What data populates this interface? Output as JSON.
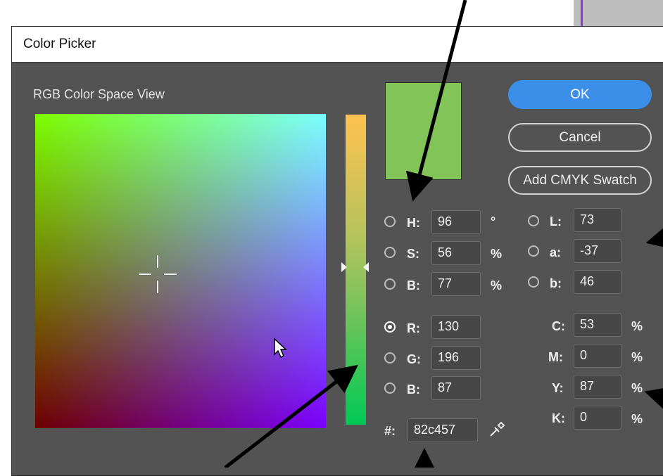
{
  "dialog": {
    "title": "Color Picker",
    "view_title": "RGB Color Space View"
  },
  "current_color": "#82c457",
  "buttons": {
    "ok": "OK",
    "cancel": "Cancel",
    "add_swatch": "Add CMYK Swatch"
  },
  "hsb": {
    "h": {
      "label": "H:",
      "value": "96",
      "unit": "°"
    },
    "s": {
      "label": "S:",
      "value": "56",
      "unit": "%"
    },
    "b": {
      "label": "B:",
      "value": "77",
      "unit": "%"
    }
  },
  "rgb": {
    "r": {
      "label": "R:",
      "value": "130"
    },
    "g": {
      "label": "G:",
      "value": "196"
    },
    "b": {
      "label": "B:",
      "value": "87"
    }
  },
  "lab": {
    "l": {
      "label": "L:",
      "value": "73"
    },
    "a": {
      "label": "a:",
      "value": "-37"
    },
    "b": {
      "label": "b:",
      "value": "46"
    }
  },
  "cmyk": {
    "c": {
      "label": "C:",
      "value": "53",
      "unit": "%"
    },
    "m": {
      "label": "M:",
      "value": "0",
      "unit": "%"
    },
    "y": {
      "label": "Y:",
      "value": "87",
      "unit": "%"
    },
    "k": {
      "label": "K:",
      "value": "0",
      "unit": "%"
    }
  },
  "hex": {
    "label": "#:",
    "value": "82c457"
  },
  "selected_mode": "R",
  "icons": {
    "crosshair": "crosshair-icon",
    "cursor": "mouse-pointer-icon",
    "eyedropper": "eyedropper-icon"
  }
}
